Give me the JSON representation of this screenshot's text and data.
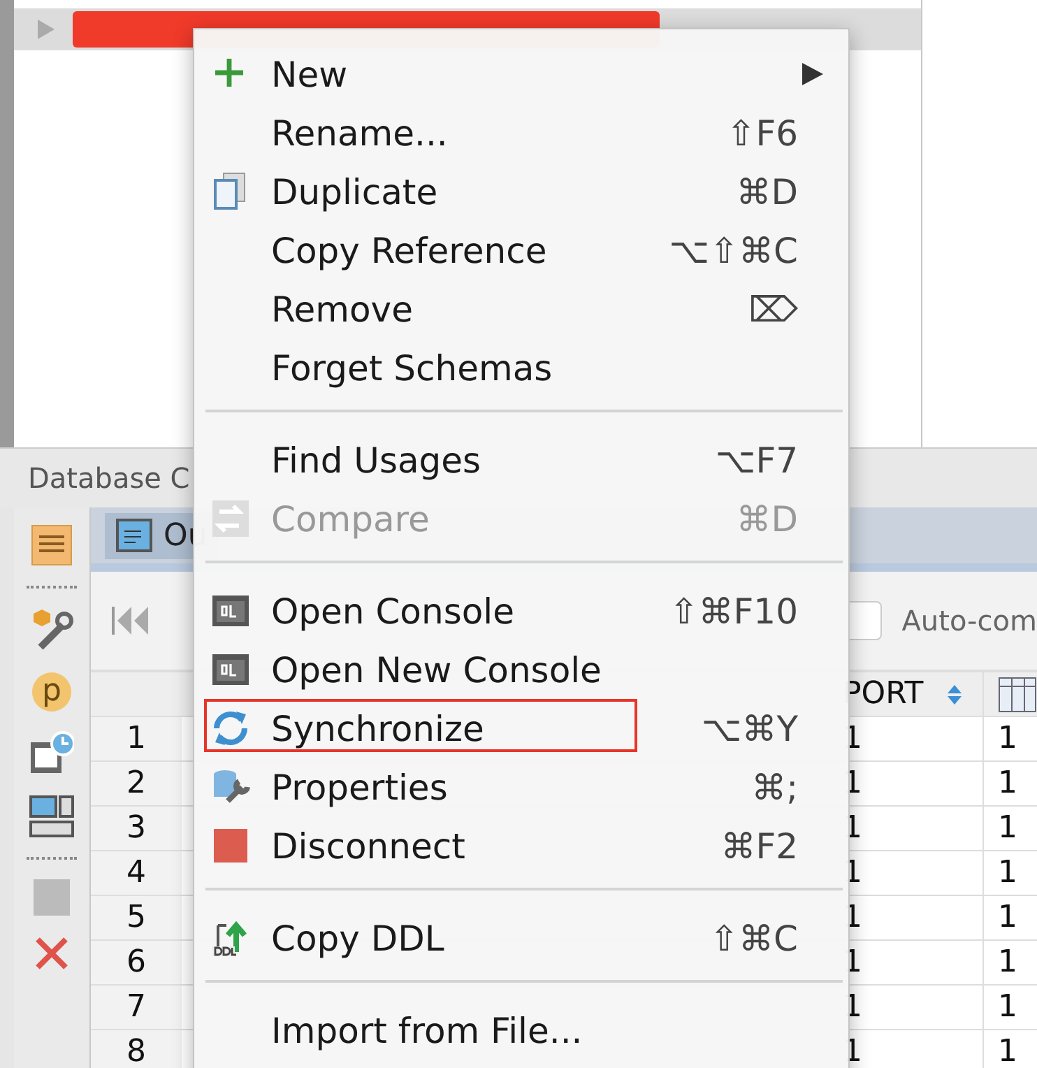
{
  "panel": {
    "title": "Database C"
  },
  "side_toolbar": {
    "badge": "p"
  },
  "tab": {
    "label": "Ou",
    "selected": true
  },
  "toolbar": {
    "auto_commit": {
      "label": "Auto-com",
      "checked": false
    }
  },
  "table": {
    "columns": [
      "",
      "PORT"
    ],
    "rows": [
      {
        "number": "1",
        "port": "1",
        "column_3": "1"
      },
      {
        "number": "2",
        "port": "1",
        "column_3": "1"
      },
      {
        "number": "3",
        "port": "1",
        "column_3": "1"
      },
      {
        "number": "4",
        "port": "1",
        "column_3": "1"
      },
      {
        "number": "5",
        "port": "1",
        "column_3": "1"
      },
      {
        "number": "6",
        "port": "1",
        "column_3": "1"
      },
      {
        "number": "7",
        "port": "1",
        "column_3": "1"
      },
      {
        "number": "8",
        "port": "1",
        "column_3": "1"
      }
    ]
  },
  "context_menu": {
    "items": [
      {
        "kind": "item",
        "label": "New",
        "submenu": true,
        "disabled": false,
        "outlined": false
      },
      {
        "kind": "item",
        "label": "Rename...",
        "shortcut": "⇧F6",
        "submenu": false,
        "disabled": false,
        "outlined": false
      },
      {
        "kind": "item",
        "label": "Duplicate",
        "shortcut": "⌘D",
        "submenu": false,
        "disabled": false,
        "outlined": false
      },
      {
        "kind": "item",
        "label": "Copy Reference",
        "shortcut": "⌥⇧⌘C",
        "submenu": false,
        "disabled": false,
        "outlined": false
      },
      {
        "kind": "item",
        "label": "Remove",
        "shortcut": "⌦",
        "submenu": false,
        "disabled": false,
        "outlined": false
      },
      {
        "kind": "item",
        "label": "Forget Schemas",
        "submenu": false,
        "disabled": false,
        "outlined": false
      },
      {
        "kind": "separator"
      },
      {
        "kind": "item",
        "label": "Find Usages",
        "shortcut": "⌥F7",
        "submenu": false,
        "disabled": false,
        "outlined": false
      },
      {
        "kind": "item",
        "label": "Compare",
        "shortcut": "⌘D",
        "submenu": false,
        "disabled": true,
        "outlined": false
      },
      {
        "kind": "separator"
      },
      {
        "kind": "item",
        "label": "Open Console",
        "shortcut": "⇧⌘F10",
        "submenu": false,
        "disabled": false,
        "outlined": false
      },
      {
        "kind": "item",
        "label": "Open New Console",
        "submenu": false,
        "disabled": false,
        "outlined": false
      },
      {
        "kind": "item",
        "label": "Synchronize",
        "shortcut": "⌥⌘Y",
        "submenu": false,
        "disabled": false,
        "outlined": true
      },
      {
        "kind": "item",
        "label": "Properties",
        "shortcut": "⌘;",
        "submenu": false,
        "disabled": false,
        "outlined": false
      },
      {
        "kind": "item",
        "label": "Disconnect",
        "shortcut": "⌘F2",
        "submenu": false,
        "disabled": false,
        "outlined": false
      },
      {
        "kind": "separator"
      },
      {
        "kind": "item",
        "label": "Copy DDL",
        "shortcut": "⇧⌘C",
        "submenu": false,
        "disabled": false,
        "outlined": false
      },
      {
        "kind": "separator"
      },
      {
        "kind": "item",
        "label": "Import from File...",
        "submenu": false,
        "disabled": false,
        "outlined": false
      }
    ]
  }
}
